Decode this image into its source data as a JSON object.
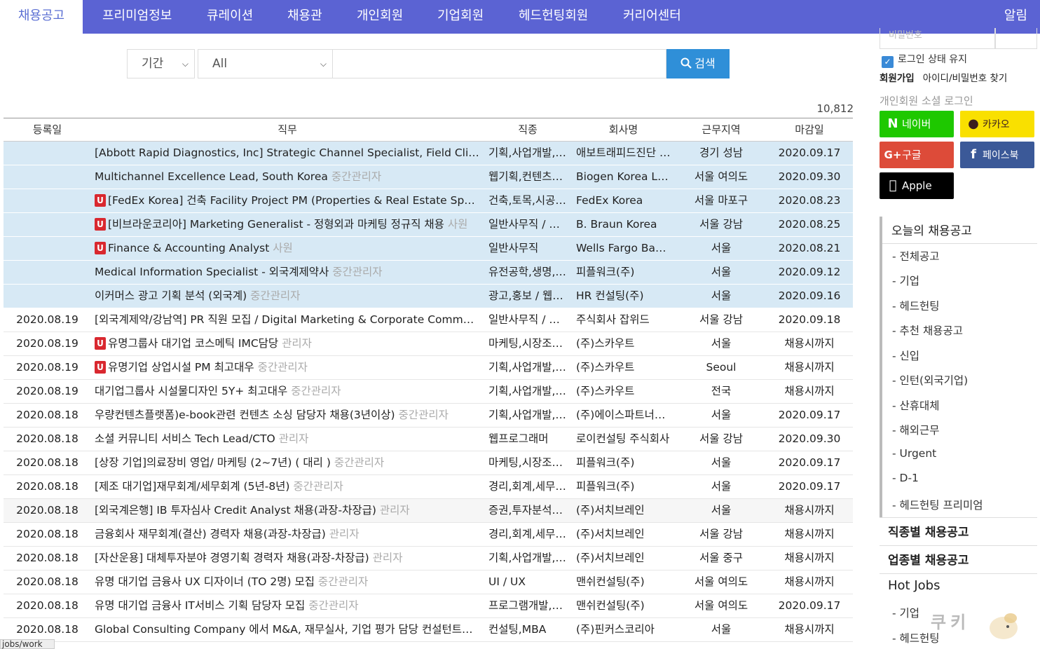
{
  "nav": {
    "active": "채용공고",
    "items": [
      "프리미엄정보",
      "큐레이션",
      "채용관",
      "개인회원",
      "기업회원",
      "헤드헌팅회원",
      "커리어센터"
    ],
    "alarm": "알림"
  },
  "search": {
    "period_label": "기간",
    "category_value": "All",
    "button_label": "검색"
  },
  "results_count": "10,812",
  "table": {
    "headers": [
      "등록일",
      "직무",
      "직종",
      "회사명",
      "근무지역",
      "마감일"
    ],
    "rows": [
      {
        "date": "",
        "badge": "",
        "title": "[Abbott Rapid Diagnostics, Inc] Strategic Channel Specialist, Field Clinical Specialist",
        "level": "",
        "category": "기획,사업개발,…",
        "company": "애보트래피드진단 …",
        "location": "경기 성남",
        "deadline": "2020.09.17",
        "style": "hl"
      },
      {
        "date": "",
        "badge": "",
        "title": "Multichannel Excellence Lead, South Korea",
        "level": "중간관리자",
        "category": "웹기획,컨텐츠…",
        "company": "Biogen Korea LLC",
        "location": "서울 여의도",
        "deadline": "2020.09.30",
        "style": "hl"
      },
      {
        "date": "",
        "badge": "U",
        "title": "[FedEx Korea] 건축 Facility Project PM (Properties & Real Estate Specialist)",
        "level": "",
        "category": "건축,토목,시공…",
        "company": "FedEx Korea",
        "location": "서울 마포구",
        "deadline": "2020.08.23",
        "style": "hl"
      },
      {
        "date": "",
        "badge": "U",
        "title": "[비브라운코리아] Marketing Generalist - 정형외과 마케팅 정규직 채용",
        "level": "사원",
        "category": "일반사무직 / …",
        "company": "B. Braun Korea",
        "location": "서울 강남",
        "deadline": "2020.08.25",
        "style": "hl"
      },
      {
        "date": "",
        "badge": "U",
        "title": "Finance & Accounting Analyst",
        "level": "사원",
        "category": "일반사무직",
        "company": "Wells Fargo Ban…",
        "location": "서울",
        "deadline": "2020.08.21",
        "style": "hl"
      },
      {
        "date": "",
        "badge": "",
        "title": "Medical Information Specialist - 외국계제약사",
        "level": "중간관리자",
        "category": "유전공학,생명,…",
        "company": "피플워크(주)",
        "location": "서울",
        "deadline": "2020.09.12",
        "style": "hl"
      },
      {
        "date": "",
        "badge": "",
        "title": "이커머스 광고 기획 분석 (외국계)",
        "level": "중간관리자",
        "category": "광고,홍보 / 웹…",
        "company": "HR 컨설팅(주)",
        "location": "서울",
        "deadline": "2020.09.16",
        "style": "hl"
      },
      {
        "date": "2020.08.19",
        "badge": "",
        "title": "[외국계제약/강남역] PR 직원 모집 / Digital Marketing & Corporate Communication",
        "level": "",
        "category": "일반사무직 / …",
        "company": "주식회사 잡위드",
        "location": "서울 강남",
        "deadline": "2020.09.18",
        "style": ""
      },
      {
        "date": "2020.08.19",
        "badge": "U",
        "title": "유명그룹사 대기업 코스메틱 IMC담당",
        "level": "관리자",
        "category": "마케팅,시장조…",
        "company": "(주)스카우트",
        "location": "서울",
        "deadline": "채용시까지",
        "style": ""
      },
      {
        "date": "2020.08.19",
        "badge": "U",
        "title": "유명기업 상업시설 PM 최고대우",
        "level": "중간관리자",
        "category": "기획,사업개발,…",
        "company": "(주)스카우트",
        "location": "Seoul",
        "deadline": "채용시까지",
        "style": ""
      },
      {
        "date": "2020.08.19",
        "badge": "",
        "title": "대기업그룹사 시설물디자인 5Y+ 최고대우",
        "level": "중간관리자",
        "category": "기획,사업개발,…",
        "company": "(주)스카우트",
        "location": "전국",
        "deadline": "채용시까지",
        "style": ""
      },
      {
        "date": "2020.08.18",
        "badge": "",
        "title": "우량컨텐츠플랫폼)e-book관련 컨텐츠 소싱 담당자 채용(3년이상)",
        "level": "중간관리자",
        "category": "기획,사업개발,…",
        "company": "(주)에이스파트너…",
        "location": "서울",
        "deadline": "2020.09.17",
        "style": ""
      },
      {
        "date": "2020.08.18",
        "badge": "",
        "title": "소셜 커뮤니티 서비스 Tech Lead/CTO",
        "level": "관리자",
        "category": "웹프로그래머",
        "company": "로이컨설팅 주식회사",
        "location": "서울 강남",
        "deadline": "2020.09.30",
        "style": ""
      },
      {
        "date": "2020.08.18",
        "badge": "",
        "title": "[상장 기업]의료장비 영업/ 마케팅 (2~7년) ( 대리 )",
        "level": "중간관리자",
        "category": "마케팅,시장조…",
        "company": "피플워크(주)",
        "location": "서울",
        "deadline": "2020.09.17",
        "style": ""
      },
      {
        "date": "2020.08.18",
        "badge": "",
        "title": "[제조 대기업]재무회계/세무회계 (5년-8년)",
        "level": "중간관리자",
        "category": "경리,회계,세무…",
        "company": "피플워크(주)",
        "location": "서울",
        "deadline": "2020.09.17",
        "style": ""
      },
      {
        "date": "2020.08.18",
        "badge": "",
        "title": "[외국계은행] IB 투자심사 Credit Analyst 채용(과장-차장급)",
        "level": "관리자",
        "category": "증권,투자분석…",
        "company": "(주)서치브레인",
        "location": "서울",
        "deadline": "채용시까지",
        "style": "alt"
      },
      {
        "date": "2020.08.18",
        "badge": "",
        "title": "금융회사 재무회계(결산) 경력자 채용(과장-차장급)",
        "level": "관리자",
        "category": "경리,회계,세무…",
        "company": "(주)서치브레인",
        "location": "서울 강남",
        "deadline": "채용시까지",
        "style": ""
      },
      {
        "date": "2020.08.18",
        "badge": "",
        "title": "[자산운용] 대체투자분야 경영기획 경력자 채용(과장-차장급)",
        "level": "관리자",
        "category": "기획,사업개발,…",
        "company": "(주)서치브레인",
        "location": "서울 중구",
        "deadline": "채용시까지",
        "style": ""
      },
      {
        "date": "2020.08.18",
        "badge": "",
        "title": "유명 대기업 금융사 UX 디자이너 (TO 2명) 모집",
        "level": "중간관리자",
        "category": "UI / UX",
        "company": "맨쉬컨설팅(주)",
        "location": "서울 여의도",
        "deadline": "채용시까지",
        "style": ""
      },
      {
        "date": "2020.08.18",
        "badge": "",
        "title": "유명 대기업 금융사 IT서비스 기획 담당자 모집",
        "level": "중간관리자",
        "category": "프로그램개발,…",
        "company": "맨쉬컨설팅(주)",
        "location": "서울 여의도",
        "deadline": "2020.09.17",
        "style": ""
      },
      {
        "date": "2020.08.18",
        "badge": "",
        "title": "Global Consulting Company 에서 M&A, 재무실사, 기업 평가 담당 컨설턴트를 모집합니다",
        "level": "",
        "category": "컨설팅,MBA",
        "company": "(주)핀커스코리아",
        "location": "서울",
        "deadline": "채용시까지",
        "style": ""
      }
    ]
  },
  "login": {
    "password_placeholder": "비밀번호",
    "keep_login": "로그인 상태 유지",
    "signup": "회원가입",
    "find": "아이디/비밀번호 찾기",
    "social_title": "개인회원 소셜 로그인",
    "naver": "네이버",
    "kakao": "카카오",
    "google": "구글",
    "facebook": "페이스북",
    "apple": "Apple"
  },
  "sidebar": {
    "today_title": "오늘의 채용공고",
    "today_items": [
      "- 전체공고",
      "- 기업",
      "- 헤드헌팅",
      "- 추천 채용공고",
      "- 신입",
      "- 인턴(외국기업)",
      "- 산휴대체",
      "- 해외근무",
      "- Urgent",
      "- D-1",
      "- 헤드헌팅 프리미엄"
    ],
    "by_job": "직종별 채용공고",
    "by_industry": "업종별 채용공고",
    "hot_jobs": "Hot Jobs",
    "hot_items": [
      "- 기업",
      "- 헤드헌팅"
    ]
  },
  "status_url": "jobs/work",
  "watermark": "쿠키",
  "colors": {
    "nav_bg": "#5b63d3",
    "search_btn": "#2f8fd8",
    "highlight_row": "#d7e9f5",
    "urgent_badge": "#d9282f",
    "naver": "#1ec800",
    "kakao": "#f9e000",
    "google": "#dd4b39",
    "facebook": "#3b5998",
    "apple": "#000000"
  }
}
